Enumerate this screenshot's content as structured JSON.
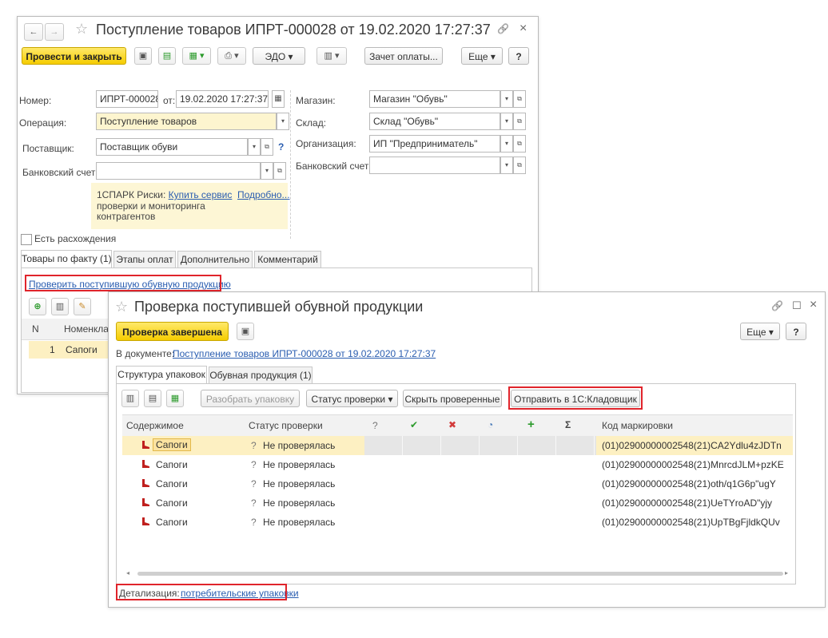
{
  "colors": {
    "accent_yellow": "#f5cc00",
    "link": "#2a5db0",
    "highlight": "#e0242b",
    "selected_row": "#fdf0c2"
  },
  "back": {
    "nav_back": "←",
    "nav_forward": "→",
    "star": "☆",
    "title": "Поступление товаров ИПРТ-000028 от 19.02.2020 17:27:37",
    "link_icon": "🔗",
    "close": "×",
    "toolbar": {
      "post_close": "Провести и закрыть",
      "edo": "ЭДО",
      "offset": "Зачет оплаты...",
      "more": "Еще",
      "help": "?"
    },
    "fields": {
      "number_label": "Номер:",
      "number": "ИПРТ-000028",
      "from_label": "от:",
      "date": "19.02.2020 17:27:37",
      "operation_label": "Операция:",
      "operation": "Поступление товаров",
      "supplier_label": "Поставщик:",
      "supplier": "Поставщик обуви",
      "bank_label": "Банковский счет:",
      "bank": "",
      "store_label": "Магазин:",
      "store": "Магазин \"Обувь\"",
      "warehouse_label": "Склад:",
      "warehouse": "Склад \"Обувь\"",
      "org_label": "Организация:",
      "org": "ИП \"Предприниматель\"",
      "bank2_label": "Банковский счет:",
      "bank2": ""
    },
    "spark": {
      "prefix": "1СПАРК Риски:",
      "buy": "Купить сервис",
      "details": "Подробно...",
      "line2": "проверки и мониторинга",
      "line3": "контрагентов"
    },
    "discrepancy": "Есть расхождения",
    "tabs": [
      "Товары по факту (1)",
      "Этапы оплат",
      "Дополнительно",
      "Комментарий"
    ],
    "check_link": "Проверить поступившую обувную продукцию",
    "table": {
      "col_n": "N",
      "col_name": "Номенклат",
      "row_n": "1",
      "row_name": "Сапоги"
    }
  },
  "front": {
    "star": "☆",
    "title": "Проверка поступившей обувной продукции",
    "link_icon": "🔗",
    "maximize": "☐",
    "close": "×",
    "done_button": "Проверка завершена",
    "more": "Еще",
    "help": "?",
    "doc_label": "В документе:",
    "doc_link": "Поступление товаров ИПРТ-000028 от 19.02.2020 17:27:37",
    "tabs": [
      "Структура упаковок",
      "Обувная продукция (1)"
    ],
    "toolbar": {
      "unpack": "Разобрать упаковку",
      "status": "Статус проверки",
      "hide": "Скрыть проверенные",
      "send": "Отправить в 1С:Кладовщик"
    },
    "columns": {
      "content": "Содержимое",
      "status": "Статус проверки",
      "q": "?",
      "ok": "✔",
      "err": "✖",
      "partial": "◔",
      "plus": "+",
      "sum": "Σ",
      "code": "Код маркировки"
    },
    "rows": [
      {
        "content": "Сапоги",
        "status_icon": "?",
        "status": "Не проверялась",
        "code": "(01)02900000002548(21)CA2Ydlu4zJDTn"
      },
      {
        "content": "Сапоги",
        "status_icon": "?",
        "status": "Не проверялась",
        "code": "(01)02900000002548(21)MnrcdJLM+pzKE"
      },
      {
        "content": "Сапоги",
        "status_icon": "?",
        "status": "Не проверялась",
        "code": "(01)02900000002548(21)oth/q1G6p\"ugY"
      },
      {
        "content": "Сапоги",
        "status_icon": "?",
        "status": "Не проверялась",
        "code": "(01)02900000002548(21)UeTYroAD\"yjy"
      },
      {
        "content": "Сапоги",
        "status_icon": "?",
        "status": "Не проверялась",
        "code": "(01)02900000002548(21)UpTBgFjldkQUv"
      }
    ],
    "detail_label": "Детализация:",
    "detail_link": "потребительские упаковки"
  }
}
